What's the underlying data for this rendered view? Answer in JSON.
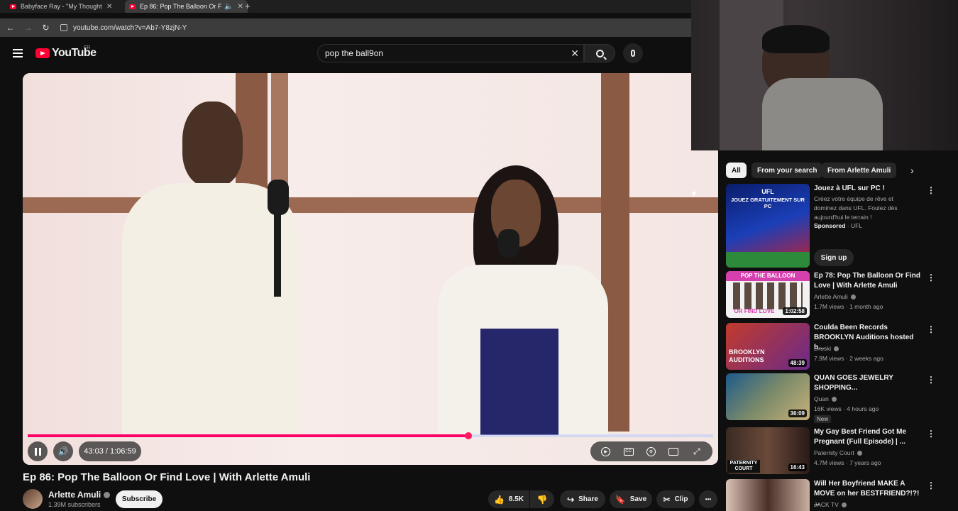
{
  "browser": {
    "tabs": [
      {
        "title": "Babyface Ray - \"My Thoughts S",
        "close": "✕"
      },
      {
        "title": "Ep 86: Pop The Balloon Or F",
        "close": "✕"
      }
    ],
    "new_tab": "+",
    "url": "youtube.com/watch?v=Ab7-Y8zjN-Y",
    "nav": {
      "back": "←",
      "forward": "→",
      "reload": "↻"
    }
  },
  "header": {
    "logo_text": "YouTube",
    "logo_country": "FR",
    "search_value": "pop the ball9on",
    "clear_glyph": "✕"
  },
  "player": {
    "time": "43:03 / 1:06:59",
    "progress": 0.643,
    "volume_glyph": "🔊",
    "icons": [
      "autoplay-icon",
      "captions-icon",
      "settings-icon",
      "theater-icon",
      "fullscreen-icon"
    ],
    "cc_text": "CC"
  },
  "video": {
    "title": "Ep 86: Pop The Balloon Or Find Love | With Arlette Amuli",
    "channel": "Arlette Amuli",
    "subscribers": "1.39M subscribers",
    "subscribe_label": "Subscribe",
    "likes": "8.5K",
    "share_label": "Share",
    "save_label": "Save",
    "clip_label": "Clip",
    "more_glyph": "•••"
  },
  "sidebar": {
    "chips": [
      "All",
      "From your search",
      "From Arlette Amuli"
    ],
    "chip_next": "›",
    "ad": {
      "title": "Jouez à UFL sur PC !",
      "desc": "Créez votre équipe de rêve et dominez dans UFL. Foulez dès aujourd'hui le terrain !",
      "sponsored": "Sponsored",
      "advertiser": "UFL",
      "cta": "Sign up",
      "thumb_logo": "UFL",
      "thumb_text": "JOUEZ GRATUITEMENT SUR PC"
    },
    "videos": [
      {
        "title": "Ep 78: Pop The Balloon Or Find Love | With Arlette Amuli",
        "channel": "Arlette Amuli",
        "stats": "1.7M views · 1 month ago",
        "duration": "1:02:58",
        "thumb_top": "POP THE BALLOON",
        "thumb_bottom": "OR FIND LOVE"
      },
      {
        "title": "Coulda Been Records BROOKLYN Auditions hosted b...",
        "channel": "Druski",
        "stats": "7.9M views · 2 weeks ago",
        "duration": "48:39",
        "thumb_text": "BROOKLYN AUDITIONS"
      },
      {
        "title": "QUAN GOES JEWELRY SHOPPING...",
        "channel": "Quan",
        "stats": "16K views · 4 hours ago",
        "duration": "36:09",
        "badge": "New"
      },
      {
        "title": "My Gay Best Friend Got Me Pregnant (Full Episode) | ...",
        "channel": "Paternity Court",
        "stats": "4.7M views · 7 years ago",
        "duration": "16:43",
        "thumb_text": "PATERNITY COURT"
      },
      {
        "title": "Will Her Boyfriend MAKE A MOVE on her BESTFRIEND?!?! ...",
        "channel": "JACK TV",
        "stats": "",
        "duration": ""
      }
    ],
    "more_glyph": "⋮"
  }
}
